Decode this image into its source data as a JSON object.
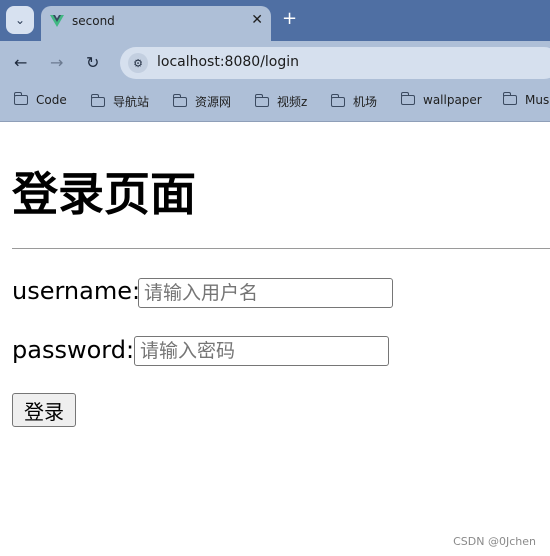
{
  "browser": {
    "tab_title": "second",
    "url": "localhost:8080/login",
    "bookmarks": [
      {
        "label": "Code"
      },
      {
        "label": "导航站"
      },
      {
        "label": "资源网"
      },
      {
        "label": "视频z"
      },
      {
        "label": "机场"
      },
      {
        "label": "wallpaper"
      },
      {
        "label": "Mus"
      }
    ],
    "colors": {
      "tabbar": "#4f6fa3",
      "toolbar": "#aebfd7",
      "addressbar": "#d6e0ee"
    }
  },
  "page": {
    "title": "登录页面",
    "username_label": "username:",
    "username_placeholder": "请输入用户名",
    "username_value": "",
    "password_label": "password:",
    "password_placeholder": "请输入密码",
    "password_value": "",
    "submit_label": "登录"
  },
  "watermark": "CSDN @0Jchen"
}
